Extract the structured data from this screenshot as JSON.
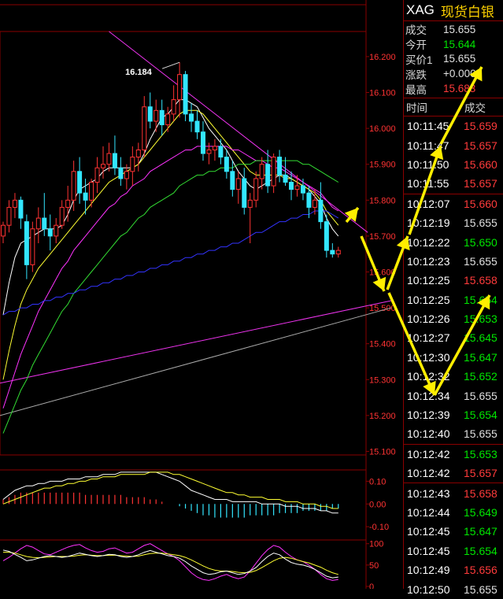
{
  "header": {
    "symbol": "XAG",
    "name": "现货白银"
  },
  "quote": [
    {
      "label": "成交",
      "value": "15.655",
      "color": "#e0e0e0"
    },
    {
      "label": "今开",
      "value": "15.644",
      "color": "#00e600"
    },
    {
      "label": "买价1",
      "value": "15.655",
      "color": "#e0e0e0"
    },
    {
      "label": "涨跌",
      "value": "+0.000",
      "color": "#e0e0e0"
    },
    {
      "label": "最高",
      "value": "15.683",
      "color": "#ff3b3b"
    }
  ],
  "ticks_header": {
    "time": "时间",
    "trade": "成交"
  },
  "ticks": [
    {
      "time": "10:11:45",
      "price": "15.659",
      "color": "red"
    },
    {
      "time": "10:11:47",
      "price": "15.657",
      "color": "red"
    },
    {
      "time": "10:11:50",
      "price": "15.660",
      "color": "red"
    },
    {
      "time": "10:11:55",
      "price": "15.657",
      "color": "red"
    },
    {
      "time": "10:12:07",
      "price": "15.660",
      "color": "red"
    },
    {
      "time": "10:12:19",
      "price": "15.655",
      "color": "white"
    },
    {
      "time": "10:12:22",
      "price": "15.650",
      "color": "green"
    },
    {
      "time": "10:12:23",
      "price": "15.655",
      "color": "white"
    },
    {
      "time": "10:12:25",
      "price": "15.658",
      "color": "red"
    },
    {
      "time": "10:12:25",
      "price": "15.654",
      "color": "green"
    },
    {
      "time": "10:12:26",
      "price": "15.653",
      "color": "green"
    },
    {
      "time": "10:12:27",
      "price": "15.645",
      "color": "green"
    },
    {
      "time": "10:12:30",
      "price": "15.647",
      "color": "green"
    },
    {
      "time": "10:12:32",
      "price": "15.652",
      "color": "green"
    },
    {
      "time": "10:12:34",
      "price": "15.655",
      "color": "white"
    },
    {
      "time": "10:12:39",
      "price": "15.654",
      "color": "green"
    },
    {
      "time": "10:12:40",
      "price": "15.655",
      "color": "white"
    },
    {
      "time": "10:12:42",
      "price": "15.653",
      "color": "green"
    },
    {
      "time": "10:12:42",
      "price": "15.657",
      "color": "red"
    },
    {
      "time": "10:12:43",
      "price": "15.658",
      "color": "red"
    },
    {
      "time": "10:12:44",
      "price": "15.649",
      "color": "green"
    },
    {
      "time": "10:12:45",
      "price": "15.647",
      "color": "green"
    },
    {
      "time": "10:12:45",
      "price": "15.654",
      "color": "green"
    },
    {
      "time": "10:12:49",
      "price": "15.656",
      "color": "red"
    },
    {
      "time": "10:12:50",
      "price": "15.655",
      "color": "white"
    }
  ],
  "tick_separators_after": [
    3,
    16,
    18
  ],
  "chart_data": {
    "type": "candlestick",
    "price_axis": {
      "ticks": [
        "16.200",
        "16.100",
        "16.000",
        "15.900",
        "15.800",
        "15.700",
        "15.600",
        "15.500",
        "15.400",
        "15.300",
        "15.200",
        "15.100"
      ],
      "ylim": [
        15.09,
        16.27
      ]
    },
    "annotations": [
      {
        "text": "16.184",
        "value": 16.184
      }
    ],
    "candles": [
      [
        15.7,
        15.74,
        15.68,
        15.73
      ],
      [
        15.73,
        15.8,
        15.71,
        15.78
      ],
      [
        15.78,
        15.82,
        15.75,
        15.8
      ],
      [
        15.8,
        15.81,
        15.72,
        15.75
      ],
      [
        15.74,
        15.76,
        15.58,
        15.62
      ],
      [
        15.62,
        15.74,
        15.6,
        15.72
      ],
      [
        15.72,
        15.78,
        15.68,
        15.75
      ],
      [
        15.75,
        15.82,
        15.7,
        15.72
      ],
      [
        15.72,
        15.76,
        15.66,
        15.7
      ],
      [
        15.7,
        15.75,
        15.68,
        15.73
      ],
      [
        15.73,
        15.8,
        15.72,
        15.78
      ],
      [
        15.78,
        15.84,
        15.74,
        15.8
      ],
      [
        15.8,
        15.91,
        15.77,
        15.88
      ],
      [
        15.88,
        15.92,
        15.79,
        15.82
      ],
      [
        15.82,
        15.86,
        15.76,
        15.8
      ],
      [
        15.8,
        15.86,
        15.78,
        15.85
      ],
      [
        15.85,
        15.92,
        15.82,
        15.89
      ],
      [
        15.89,
        15.95,
        15.86,
        15.9
      ],
      [
        15.9,
        15.96,
        15.88,
        15.93
      ],
      [
        15.93,
        15.98,
        15.87,
        15.89
      ],
      [
        15.89,
        15.92,
        15.84,
        15.86
      ],
      [
        15.86,
        15.9,
        15.83,
        15.88
      ],
      [
        15.88,
        15.95,
        15.84,
        15.92
      ],
      [
        15.92,
        15.96,
        15.88,
        15.94
      ],
      [
        15.94,
        16.09,
        15.92,
        16.06
      ],
      [
        16.06,
        16.1,
        16.0,
        16.02
      ],
      [
        16.02,
        16.08,
        15.99,
        16.05
      ],
      [
        16.05,
        16.08,
        15.98,
        16.01
      ],
      [
        16.01,
        16.06,
        15.99,
        16.04
      ],
      [
        16.04,
        16.12,
        16.02,
        16.08
      ],
      [
        16.08,
        16.184,
        16.03,
        16.15
      ],
      [
        16.15,
        16.16,
        16.02,
        16.04
      ],
      [
        16.04,
        16.07,
        15.99,
        16.02
      ],
      [
        16.02,
        16.05,
        15.97,
        15.99
      ],
      [
        15.99,
        16.02,
        15.91,
        15.93
      ],
      [
        15.93,
        15.96,
        15.9,
        15.94
      ],
      [
        15.94,
        15.97,
        15.91,
        15.95
      ],
      [
        15.95,
        15.97,
        15.9,
        15.92
      ],
      [
        15.92,
        15.94,
        15.86,
        15.88
      ],
      [
        15.88,
        15.91,
        15.81,
        15.83
      ],
      [
        15.83,
        15.88,
        15.79,
        15.86
      ],
      [
        15.86,
        15.89,
        15.76,
        15.78
      ],
      [
        15.78,
        15.82,
        15.68,
        15.8
      ],
      [
        15.8,
        15.88,
        15.78,
        15.86
      ],
      [
        15.86,
        15.92,
        15.83,
        15.9
      ],
      [
        15.9,
        15.94,
        15.82,
        15.84
      ],
      [
        15.84,
        15.93,
        15.82,
        15.92
      ],
      [
        15.92,
        15.94,
        15.85,
        15.87
      ],
      [
        15.87,
        15.92,
        15.84,
        15.85
      ],
      [
        15.85,
        15.88,
        15.8,
        15.83
      ],
      [
        15.83,
        15.87,
        15.81,
        15.84
      ],
      [
        15.84,
        15.86,
        15.8,
        15.82
      ],
      [
        15.82,
        15.84,
        15.75,
        15.78
      ],
      [
        15.78,
        15.83,
        15.76,
        15.8
      ],
      [
        15.8,
        15.85,
        15.72,
        15.74
      ],
      [
        15.74,
        15.76,
        15.64,
        15.66
      ],
      [
        15.66,
        15.68,
        15.64,
        15.65
      ],
      [
        15.65,
        15.67,
        15.64,
        15.66
      ]
    ],
    "moving_averages": [
      {
        "color": "#ffffff",
        "values": [
          15.48,
          15.57,
          15.64,
          15.68,
          15.69,
          15.7,
          15.71,
          15.72,
          15.72,
          15.72,
          15.73,
          15.76,
          15.8,
          15.83,
          15.84,
          15.85,
          15.86,
          15.88,
          15.89,
          15.89,
          15.89,
          15.89,
          15.89,
          15.9,
          15.93,
          15.97,
          16.0,
          16.03,
          16.04,
          16.06,
          16.08,
          16.08,
          16.07,
          16.06,
          16.03,
          16.0,
          15.98,
          15.96,
          15.94,
          15.91,
          15.88,
          15.86,
          15.84,
          15.83,
          15.84,
          15.85,
          15.86,
          15.87,
          15.87,
          15.86,
          15.85,
          15.84,
          15.83,
          15.81,
          15.79,
          15.75,
          15.72,
          15.7
        ]
      },
      {
        "color": "#ffff33",
        "values": [
          15.3,
          15.38,
          15.45,
          15.51,
          15.55,
          15.58,
          15.61,
          15.63,
          15.65,
          15.67,
          15.69,
          15.71,
          15.73,
          15.75,
          15.77,
          15.79,
          15.81,
          15.83,
          15.85,
          15.86,
          15.87,
          15.88,
          15.89,
          15.9,
          15.92,
          15.94,
          15.96,
          15.98,
          16.0,
          16.02,
          16.04,
          16.05,
          16.05,
          16.05,
          16.04,
          16.02,
          16.0,
          15.98,
          15.96,
          15.94,
          15.92,
          15.9,
          15.88,
          15.87,
          15.87,
          15.87,
          15.87,
          15.87,
          15.86,
          15.86,
          15.85,
          15.84,
          15.83,
          15.82,
          15.8,
          15.77,
          15.75,
          15.73
        ]
      },
      {
        "color": "#ff33ff",
        "values": [
          15.22,
          15.27,
          15.32,
          15.37,
          15.41,
          15.45,
          15.49,
          15.52,
          15.55,
          15.58,
          15.61,
          15.63,
          15.66,
          15.68,
          15.7,
          15.72,
          15.74,
          15.76,
          15.78,
          15.79,
          15.81,
          15.82,
          15.84,
          15.85,
          15.86,
          15.88,
          15.89,
          15.9,
          15.91,
          15.92,
          15.93,
          15.94,
          15.94,
          15.95,
          15.95,
          15.95,
          15.95,
          15.95,
          15.95,
          15.94,
          15.94,
          15.93,
          15.92,
          15.91,
          15.91,
          15.9,
          15.89,
          15.89,
          15.88,
          15.87,
          15.86,
          15.85,
          15.84,
          15.83,
          15.82,
          15.8,
          15.78,
          15.77
        ]
      },
      {
        "color": "#33dd33",
        "values": [
          15.15,
          15.19,
          15.23,
          15.27,
          15.3,
          15.34,
          15.37,
          15.4,
          15.43,
          15.46,
          15.49,
          15.51,
          15.54,
          15.56,
          15.58,
          15.6,
          15.62,
          15.64,
          15.66,
          15.68,
          15.7,
          15.71,
          15.73,
          15.75,
          15.76,
          15.78,
          15.79,
          15.8,
          15.81,
          15.82,
          15.84,
          15.85,
          15.86,
          15.87,
          15.87,
          15.88,
          15.88,
          15.89,
          15.89,
          15.89,
          15.9,
          15.9,
          15.9,
          15.91,
          15.91,
          15.91,
          15.91,
          15.91,
          15.91,
          15.91,
          15.91,
          15.9,
          15.9,
          15.89,
          15.88,
          15.87,
          15.86,
          15.85
        ]
      },
      {
        "color": "#3333ff",
        "values": [
          15.48,
          15.49,
          15.49,
          15.5,
          15.5,
          15.51,
          15.51,
          15.52,
          15.52,
          15.53,
          15.53,
          15.54,
          15.54,
          15.55,
          15.55,
          15.56,
          15.56,
          15.57,
          15.57,
          15.58,
          15.58,
          15.59,
          15.59,
          15.6,
          15.6,
          15.61,
          15.61,
          15.62,
          15.62,
          15.63,
          15.63,
          15.64,
          15.64,
          15.65,
          15.65,
          15.66,
          15.66,
          15.67,
          15.67,
          15.68,
          15.68,
          15.69,
          15.7,
          15.71,
          15.71,
          15.72,
          15.73,
          15.74,
          15.74,
          15.75,
          15.75,
          15.76,
          15.76,
          15.77,
          15.77,
          15.77,
          15.76,
          15.75
        ]
      }
    ],
    "long_ma_lines": [
      {
        "color": "#ee33ee",
        "from": 15.29,
        "to": 15.52
      },
      {
        "color": "#aaaaaa",
        "from": 15.2,
        "to": 15.5
      }
    ],
    "trend_line": {
      "color": "#ee33ee",
      "from_candle": 18,
      "from_value": 16.27,
      "to_candle": 62,
      "to_value": 15.71
    },
    "macd_panel": {
      "ticks": [
        "0.10",
        "0.00",
        "-0.10"
      ],
      "ylim": [
        -0.11,
        0.15
      ],
      "histogram": [
        0.02,
        0.03,
        0.04,
        0.05,
        0.05,
        0.05,
        0.05,
        0.05,
        0.05,
        0.05,
        0.05,
        0.05,
        0.05,
        0.05,
        0.04,
        0.04,
        0.04,
        0.04,
        0.04,
        0.04,
        0.04,
        0.03,
        0.03,
        0.03,
        0.03,
        0.02,
        0.02,
        0.01,
        0.0,
        0.0,
        -0.01,
        -0.02,
        -0.03,
        -0.04,
        -0.05,
        -0.05,
        -0.06,
        -0.06,
        -0.06,
        -0.06,
        -0.06,
        -0.06,
        -0.05,
        -0.05,
        -0.05,
        -0.05,
        -0.05,
        -0.04,
        -0.04,
        -0.04,
        -0.04,
        -0.03,
        -0.03,
        -0.03,
        -0.03,
        -0.03,
        -0.02,
        -0.02
      ],
      "dif": [
        0.02,
        0.04,
        0.06,
        0.07,
        0.08,
        0.08,
        0.09,
        0.09,
        0.1,
        0.1,
        0.1,
        0.11,
        0.11,
        0.11,
        0.12,
        0.12,
        0.12,
        0.13,
        0.13,
        0.13,
        0.14,
        0.14,
        0.14,
        0.14,
        0.14,
        0.14,
        0.14,
        0.13,
        0.12,
        0.11,
        0.1,
        0.08,
        0.06,
        0.05,
        0.04,
        0.03,
        0.02,
        0.02,
        0.02,
        0.01,
        0.01,
        0.01,
        0.01,
        0.01,
        0.0,
        0.0,
        0.0,
        0.0,
        -0.01,
        -0.01,
        -0.01,
        -0.02,
        -0.02,
        -0.02,
        -0.03,
        -0.03,
        -0.04,
        -0.04
      ],
      "dea": [
        0.0,
        0.01,
        0.02,
        0.03,
        0.04,
        0.05,
        0.06,
        0.07,
        0.07,
        0.08,
        0.08,
        0.09,
        0.09,
        0.1,
        0.1,
        0.11,
        0.11,
        0.12,
        0.12,
        0.12,
        0.13,
        0.13,
        0.13,
        0.13,
        0.13,
        0.14,
        0.14,
        0.14,
        0.14,
        0.13,
        0.13,
        0.12,
        0.11,
        0.1,
        0.09,
        0.08,
        0.07,
        0.06,
        0.05,
        0.05,
        0.04,
        0.04,
        0.03,
        0.03,
        0.03,
        0.02,
        0.02,
        0.02,
        0.01,
        0.01,
        0.01,
        0.0,
        0.0,
        0.0,
        -0.01,
        -0.01,
        -0.02,
        -0.02
      ]
    },
    "kdj_panel": {
      "ticks": [
        "100",
        "50",
        "0"
      ],
      "ylim": [
        0,
        105
      ],
      "k": [
        85,
        82,
        75,
        68,
        60,
        62,
        66,
        70,
        72,
        70,
        68,
        70,
        74,
        78,
        75,
        72,
        70,
        72,
        75,
        74,
        70,
        68,
        70,
        74,
        80,
        84,
        80,
        76,
        72,
        70,
        66,
        58,
        48,
        40,
        32,
        28,
        30,
        34,
        36,
        32,
        28,
        30,
        36,
        44,
        58,
        70,
        78,
        74,
        64,
        56,
        52,
        50,
        46,
        40,
        32,
        24,
        20,
        22
      ],
      "d": [
        80,
        80,
        78,
        74,
        70,
        68,
        67,
        68,
        69,
        70,
        70,
        70,
        71,
        73,
        74,
        73,
        72,
        72,
        73,
        73,
        72,
        71,
        70,
        71,
        74,
        77,
        78,
        78,
        76,
        74,
        72,
        68,
        62,
        55,
        48,
        42,
        38,
        36,
        36,
        35,
        33,
        32,
        33,
        37,
        44,
        52,
        60,
        66,
        68,
        66,
        62,
        58,
        55,
        50,
        45,
        38,
        32,
        28
      ],
      "j": [
        60,
        68,
        78,
        88,
        96,
        92,
        84,
        76,
        74,
        80,
        86,
        92,
        96,
        98,
        90,
        84,
        80,
        82,
        88,
        90,
        84,
        78,
        80,
        88,
        96,
        100,
        92,
        84,
        76,
        70,
        60,
        46,
        32,
        22,
        16,
        14,
        18,
        24,
        28,
        22,
        18,
        22,
        36,
        54,
        72,
        86,
        96,
        92,
        80,
        70,
        62,
        58,
        50,
        40,
        28,
        18,
        14,
        16
      ]
    }
  }
}
